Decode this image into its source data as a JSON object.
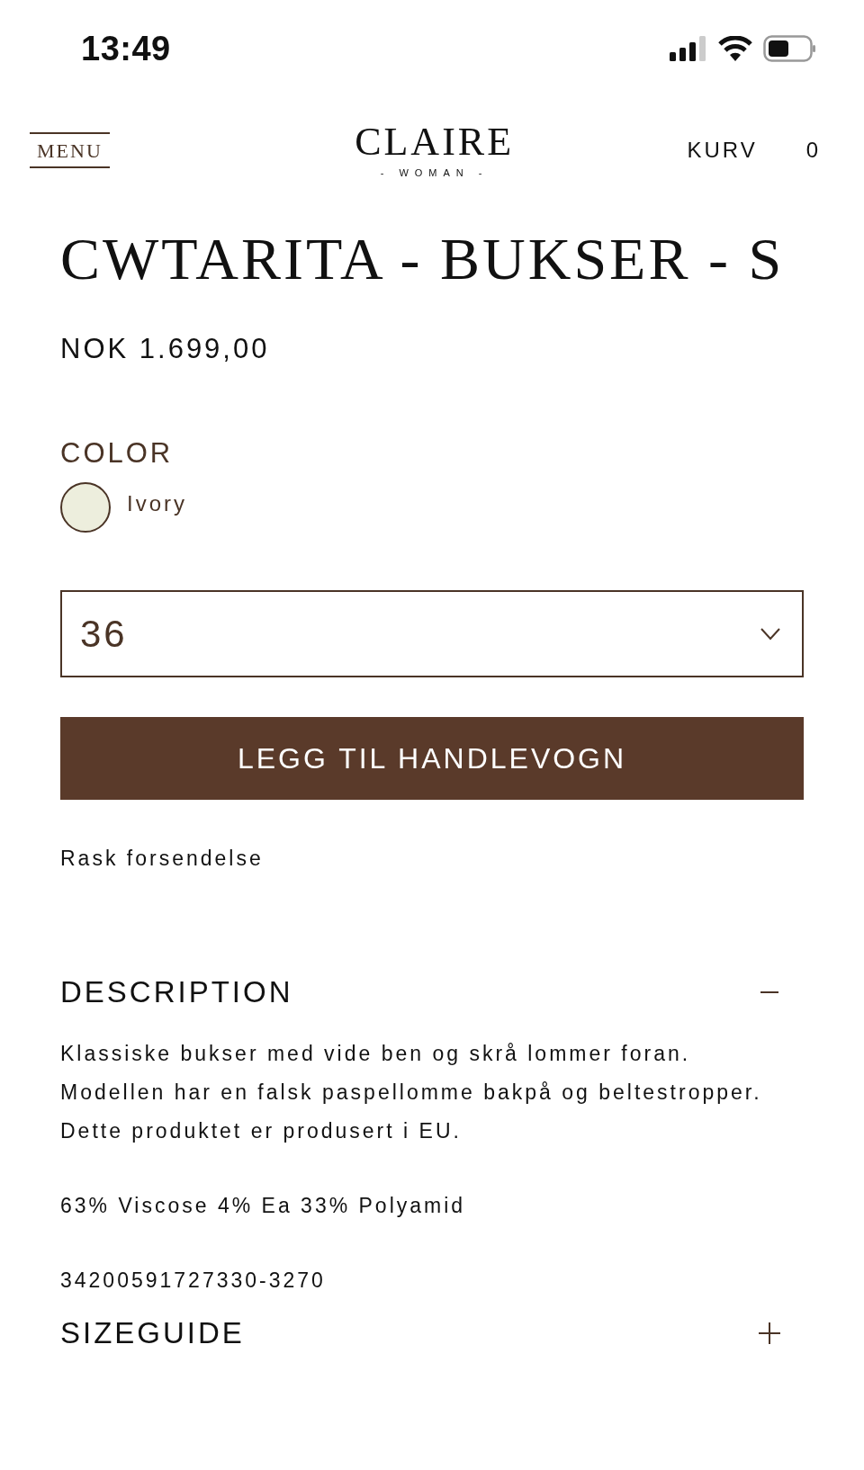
{
  "status_bar": {
    "time": "13:49"
  },
  "header": {
    "menu": "MENU",
    "logo": "CLAIRE",
    "logo_sub": "- WOMAN -",
    "cart_label": "KURV",
    "cart_count": "0"
  },
  "product": {
    "title": "CWTARITA - BUKSER - S",
    "price": "NOK 1.699,00"
  },
  "color": {
    "label": "COLOR",
    "swatches": [
      {
        "name": "Ivory",
        "color": "#edeedd"
      }
    ]
  },
  "size_select": {
    "value": "36"
  },
  "add_button": "LEGG TIL HANDLEVOGN",
  "shipping_note": "Rask forsendelse",
  "sections": [
    {
      "title": "DESCRIPTION",
      "expanded": true,
      "paragraphs": [
        "Klassiske bukser med vide ben og skrå lommer foran.\nModellen har en falsk paspellomme bakpå og beltestropper.\nDette produktet er produsert i EU.",
        "63% Viscose 4% Ea 33% Polyamid",
        "34200591727330-3270"
      ]
    },
    {
      "title": "SIZEGUIDE",
      "expanded": false
    }
  ]
}
